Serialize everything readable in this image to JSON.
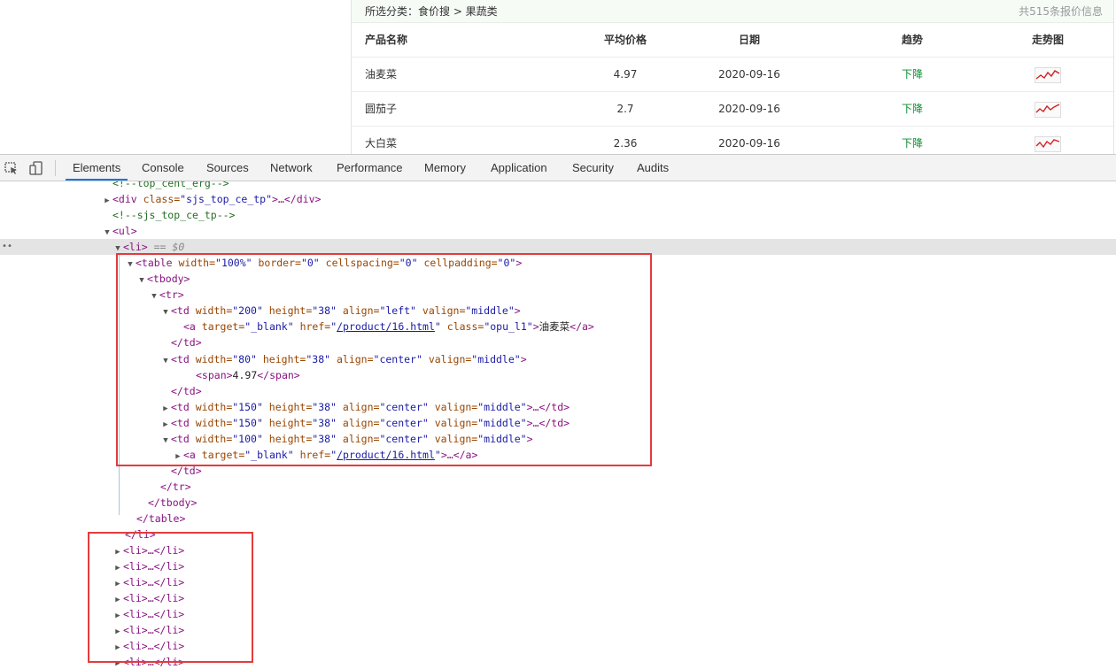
{
  "page": {
    "breadcrumb": "所选分类：食价搜 > 果蔬类",
    "total_count": "共515条报价信息",
    "headers": [
      "产品名称",
      "平均价格",
      "日期",
      "趋势",
      "走势图"
    ],
    "rows": [
      {
        "name": "油麦菜",
        "price": "4.97",
        "date": "2020-09-16",
        "trend": "下降"
      },
      {
        "name": "圆茄子",
        "price": "2.7",
        "date": "2020-09-16",
        "trend": "下降"
      },
      {
        "name": "大白菜",
        "price": "2.36",
        "date": "2020-09-16",
        "trend": "下降"
      }
    ],
    "colors": {
      "trend_down": "#0a8a2e",
      "sparkline": "#d42020"
    }
  },
  "devtools": {
    "icons": [
      "inspect-element-icon",
      "device-toggle-icon"
    ],
    "tabs": [
      "Elements",
      "Console",
      "Sources",
      "Network",
      "Performance",
      "Memory",
      "Application",
      "Security",
      "Audits"
    ],
    "active_tab": "Elements",
    "dom": {
      "l0": "<!--top_cent_erg-->",
      "l1_tag": "<div ",
      "l1_attr": "class=",
      "l1_val": "\"sjs_top_ce_tp\"",
      "l1_end": ">…</div>",
      "l2": "<!--sjs_top_ce_tp-->",
      "l3": "<ul>",
      "l4": "<li>",
      "l4_eq": " == $0",
      "l5_tag": "<table ",
      "l5_a1": "width=",
      "l5_v1": "\"100%\"",
      "l5_a2": " border=",
      "l5_v2": "\"0\"",
      "l5_a3": " cellspacing=",
      "l5_v3": "\"0\"",
      "l5_a4": " cellpadding=",
      "l5_v4": "\"0\"",
      "l5_end": ">",
      "l6": "<tbody>",
      "l7": "<tr>",
      "td_open": "<td ",
      "a_width": "width=",
      "a_height": " height=",
      "a_align": " align=",
      "a_valign": " valign=",
      "v200": "\"200\"",
      "v80": "\"80\"",
      "v150": "\"150\"",
      "v100": "\"100\"",
      "v38": "\"38\"",
      "vleft": "\"left\"",
      "vcenter": "\"center\"",
      "vmiddle": "\"middle\"",
      "gt": ">",
      "td_collapsed": ">…</td>",
      "a_open": "<a ",
      "a_target": "target=",
      "v_blank": "\"_blank\"",
      "a_href": " href=",
      "link": "/product/16.html",
      "a_class": " class=",
      "v_opu": "\"opu_l1\"",
      "a_text": "油麦菜",
      "a_close": "</a>",
      "a_collapsed": ">…</a>",
      "quote": "\"",
      "td_close": "</td>",
      "span_open": "<span>",
      "span_text": "4.97",
      "span_close": "</span>",
      "tr_close": "</tr>",
      "tbody_close": "</tbody>",
      "table_close": "</table>",
      "li_close": "</li>",
      "li_collapsed": "<li>…</li>"
    }
  }
}
